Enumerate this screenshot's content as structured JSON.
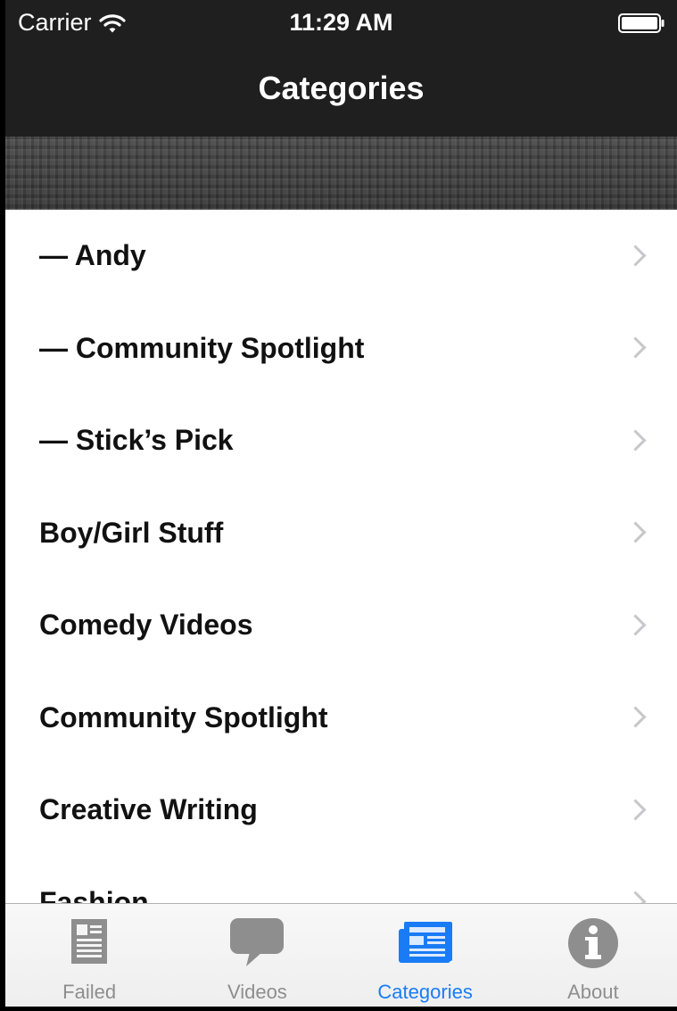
{
  "status_bar": {
    "carrier": "Carrier",
    "time": "11:29 AM"
  },
  "nav": {
    "title": "Categories"
  },
  "categories": [
    {
      "label": "— Andy"
    },
    {
      "label": "— Community Spotlight"
    },
    {
      "label": "— Stick’s Pick"
    },
    {
      "label": "Boy/Girl Stuff"
    },
    {
      "label": "Comedy Videos"
    },
    {
      "label": "Community Spotlight"
    },
    {
      "label": "Creative Writing"
    },
    {
      "label": "Fashion"
    }
  ],
  "tabs": [
    {
      "label": "Failed",
      "icon": "document-icon",
      "active": false
    },
    {
      "label": "Videos",
      "icon": "speech-bubble-icon",
      "active": false
    },
    {
      "label": "Categories",
      "icon": "newspaper-icon",
      "active": true
    },
    {
      "label": "About",
      "icon": "info-icon",
      "active": false
    }
  ],
  "colors": {
    "accent": "#1a7cf5",
    "inactive_tab": "#8e8e8e",
    "nav_background": "#1f1f1f"
  }
}
